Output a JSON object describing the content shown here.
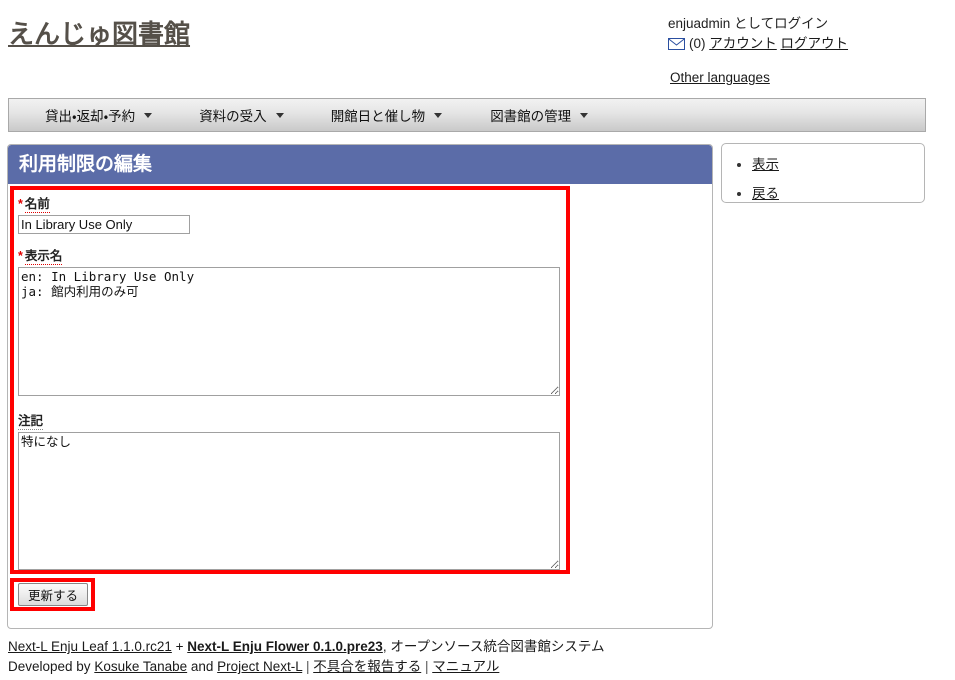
{
  "header": {
    "site_title": "えんじゅ図書館",
    "login_prefix": "enjuadmin",
    "login_suffix": " としてログイン",
    "message_icon": "envelope-icon",
    "message_count": "(0)",
    "account_label": "アカウント",
    "logout_label": "ログアウト",
    "other_languages_label": "Other languages"
  },
  "nav": {
    "items": [
      {
        "label": "貸出・返却・予約"
      },
      {
        "label": "資料の受入"
      },
      {
        "label": "開館日と催し物"
      },
      {
        "label": "図書館の管理"
      }
    ]
  },
  "page": {
    "title": "利用制限の編集"
  },
  "form": {
    "name": {
      "label": "名前",
      "required_marker": "*",
      "value": "In Library Use Only"
    },
    "display_name": {
      "label": "表示名",
      "required_marker": "*",
      "value": "en: In Library Use Only\nja: 館内利用のみ可"
    },
    "note": {
      "label": "注記",
      "value": "特になし"
    },
    "submit_label": "更新する"
  },
  "sidebar": {
    "items": [
      {
        "label": "表示"
      },
      {
        "label": "戻る"
      }
    ]
  },
  "footer": {
    "leaf_link": "Next-L Enju Leaf 1.1.0.rc21",
    "plus": " + ",
    "flower_link": "Next-L Enju Flower 0.1.0.pre23",
    "tagline": ", オープンソース統合図書館システム",
    "developed_by": "Developed by ",
    "author_link": "Kosuke Tanabe",
    "and": " and ",
    "project_link": "Project Next-L",
    "sep1": " | ",
    "bug_link": "不具合を報告する",
    "sep2": " | ",
    "manual_link": "マニュアル"
  },
  "colors": {
    "title_bar": "#5b6ca8",
    "highlight": "#ff0000",
    "required": "#e00000",
    "site_title": "#555049"
  }
}
